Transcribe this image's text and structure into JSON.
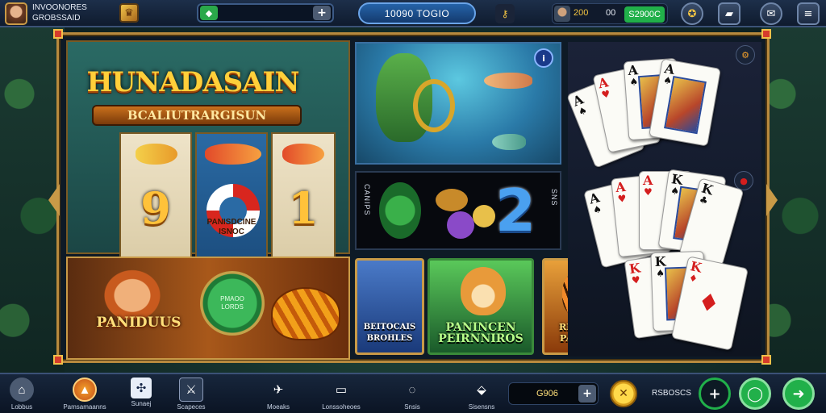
{
  "topbar": {
    "player_name_line1": "INVOONORES",
    "player_name_line2": "GROBSSAID",
    "balance_pill": "10090 TOGIO",
    "wallet_level": "200",
    "wallet_label": "00",
    "wallet_coins": "S2900C"
  },
  "slot_game": {
    "title": "HUNADASAIN",
    "subtitle": "BCALIUTRARGISUN",
    "reel_left_number": "9",
    "reel_right_number": "1",
    "reel_center_caption_line1": "PANISDCINE",
    "reel_center_caption_line2": "ISNOC"
  },
  "bonus_game": {
    "label": "PANIDUUS",
    "coin_text_line1": "PMAOO",
    "coin_text_line2": "LORDS"
  },
  "chips_game": {
    "big_number": "2",
    "left_text": "CANIPS",
    "right_text": "SNS"
  },
  "tiles": [
    {
      "label_line1": "BEITOCAIS",
      "label_line2": "BROHLES",
      "color": "#2a4a8a"
    },
    {
      "label_line1": "PANINCEN",
      "label_line2": "PEIRNNIROS",
      "color": "#2a6a3a"
    },
    {
      "label_line1": "REUAUR",
      "label_line2": "PANEER",
      "color": "#8a3a0a"
    }
  ],
  "cards": {
    "ranks": [
      "A",
      "A",
      "K",
      "K"
    ],
    "suits": [
      "♠",
      "♥",
      "♦",
      "♣"
    ]
  },
  "bottombar": {
    "nav": [
      {
        "label": "Lobbus",
        "icon": "home-icon"
      },
      {
        "label": "Pamsamaanns",
        "icon": "promotions-icon"
      },
      {
        "label": "Sunaej",
        "icon": "clubs-icon"
      },
      {
        "label": "Scapeces",
        "icon": "tools-icon"
      },
      {
        "label": "Moeaks",
        "icon": "bird-icon"
      },
      {
        "label": "Lonssoheoes",
        "icon": "clipboard-icon"
      },
      {
        "label": "Snsis",
        "icon": "chat-icon"
      },
      {
        "label": "Sisensns",
        "icon": "location-icon"
      }
    ],
    "coin_value": "G906",
    "right_label": "RSBOSCS"
  },
  "colors": {
    "accent_gold": "#c99a47",
    "topbar_bg": "#1d2f4a",
    "green_button": "#21b04a"
  }
}
